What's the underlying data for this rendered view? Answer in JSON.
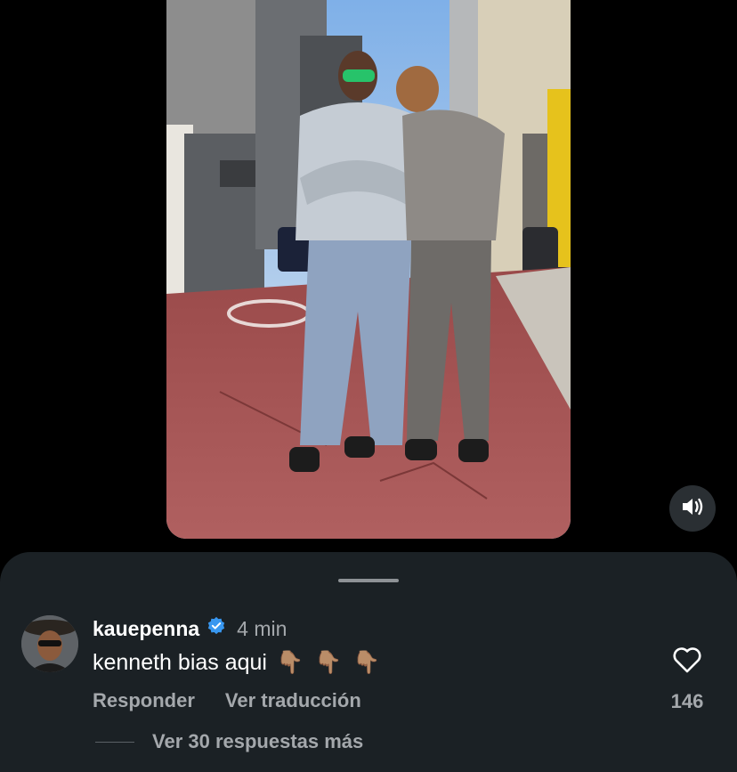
{
  "video": {
    "sound_icon": "speaker-volume-icon"
  },
  "comment": {
    "username": "kauepenna",
    "verified_icon": "verified-badge-icon",
    "time": "4 min",
    "text": "kenneth bias aqui",
    "emojis": [
      "👇🏽",
      "👇🏽",
      "👇🏽"
    ],
    "reply_label": "Responder",
    "translate_label": "Ver traducción",
    "like_icon": "heart-outline-icon",
    "likes": "146",
    "view_replies_label": "Ver 30 respuestas más"
  },
  "colors": {
    "sheet": "#1b2125",
    "verified": "#3897f0",
    "muted_text": "#a4a8ac"
  }
}
